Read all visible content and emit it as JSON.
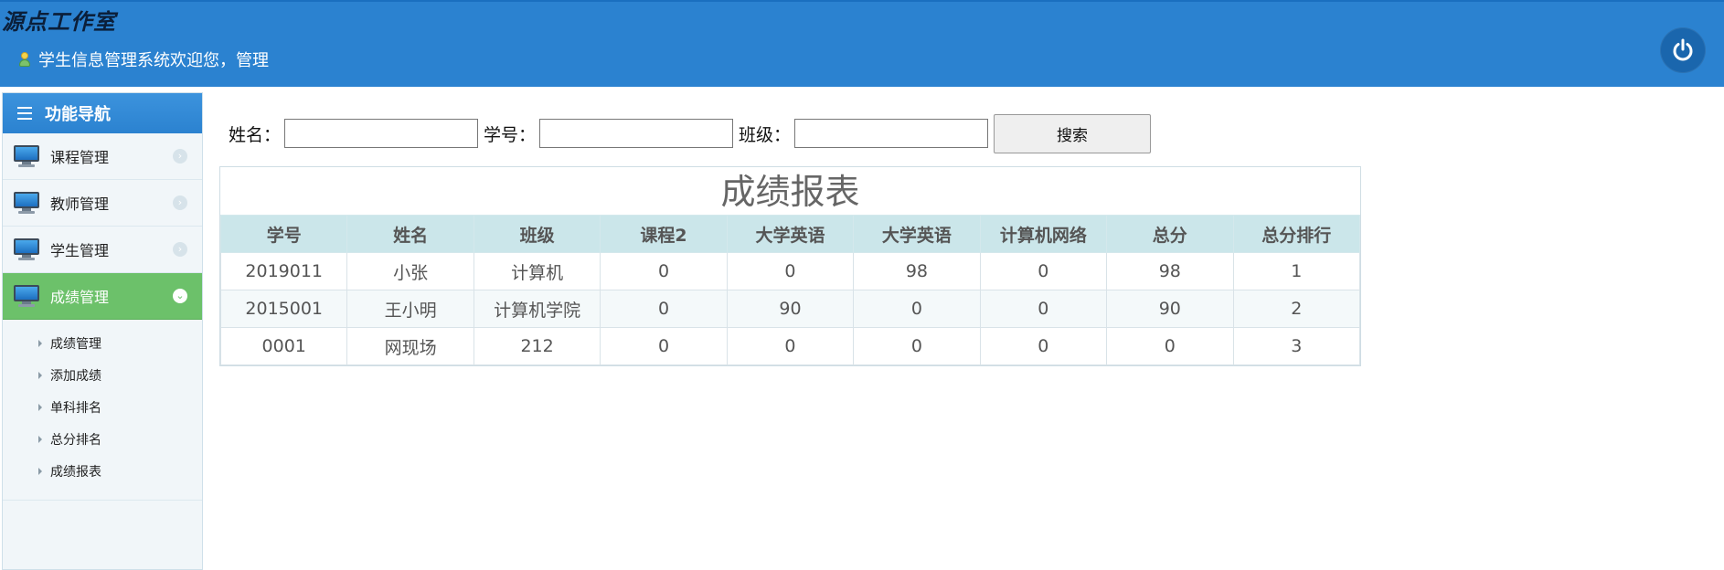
{
  "header": {
    "brand": "源点工作室",
    "welcome": "学生信息管理系统欢迎您，管理",
    "user_icon": "user-icon",
    "power_icon": "power-icon",
    "bg_color": "#2b82d0"
  },
  "sidebar": {
    "title": "功能导航",
    "items": [
      {
        "label": "课程管理",
        "icon": "monitor-icon"
      },
      {
        "label": "教师管理",
        "icon": "monitor-icon"
      },
      {
        "label": "学生管理",
        "icon": "monitor-icon"
      },
      {
        "label": "成绩管理",
        "icon": "monitor-icon",
        "active": true
      }
    ],
    "sub_items": [
      {
        "label": "成绩管理"
      },
      {
        "label": "添加成绩"
      },
      {
        "label": "单科排名"
      },
      {
        "label": "总分排名"
      },
      {
        "label": "成绩报表"
      }
    ],
    "active_color": "#6cc16a"
  },
  "search": {
    "name_label": "姓名：",
    "name_value": "",
    "id_label": "学号：",
    "id_value": "",
    "class_label": "班级：",
    "class_value": "",
    "button_label": "搜索"
  },
  "report": {
    "title": "成绩报表",
    "columns": [
      "学号",
      "姓名",
      "班级",
      "课程2",
      "大学英语",
      "大学英语",
      "计算机网络",
      "总分",
      "总分排行"
    ],
    "rows": [
      [
        "2019011",
        "小张",
        "计算机",
        "0",
        "0",
        "98",
        "0",
        "98",
        "1"
      ],
      [
        "2015001",
        "王小明",
        "计算机学院",
        "0",
        "90",
        "0",
        "0",
        "90",
        "2"
      ],
      [
        "0001",
        "网现场",
        "212",
        "0",
        "0",
        "0",
        "0",
        "0",
        "3"
      ]
    ]
  }
}
